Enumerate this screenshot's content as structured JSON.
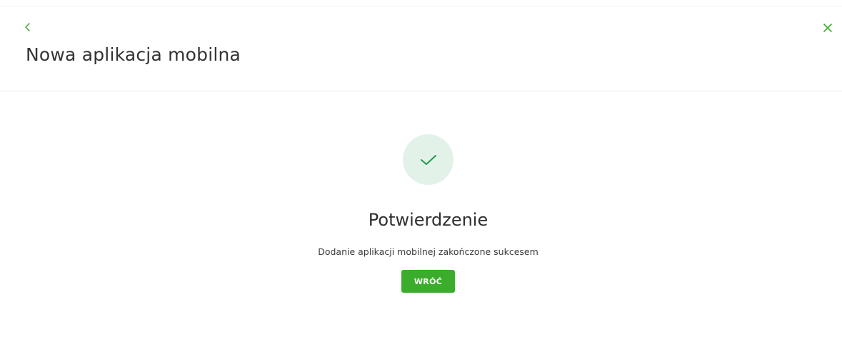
{
  "header": {
    "title": "Nowa aplikacja mobilna",
    "back_icon": "chevron-left-icon",
    "close_icon": "close-icon"
  },
  "confirmation": {
    "status_icon": "check-icon",
    "title": "Potwierdzenie",
    "message": "Dodanie aplikacji mobilnej zakończone sukcesem",
    "button_label": "WRÓĆ"
  },
  "colors": {
    "accent": "#3bac2c",
    "success_circle_bg": "#e3f2e9",
    "checkmark": "#1f9a4e"
  }
}
